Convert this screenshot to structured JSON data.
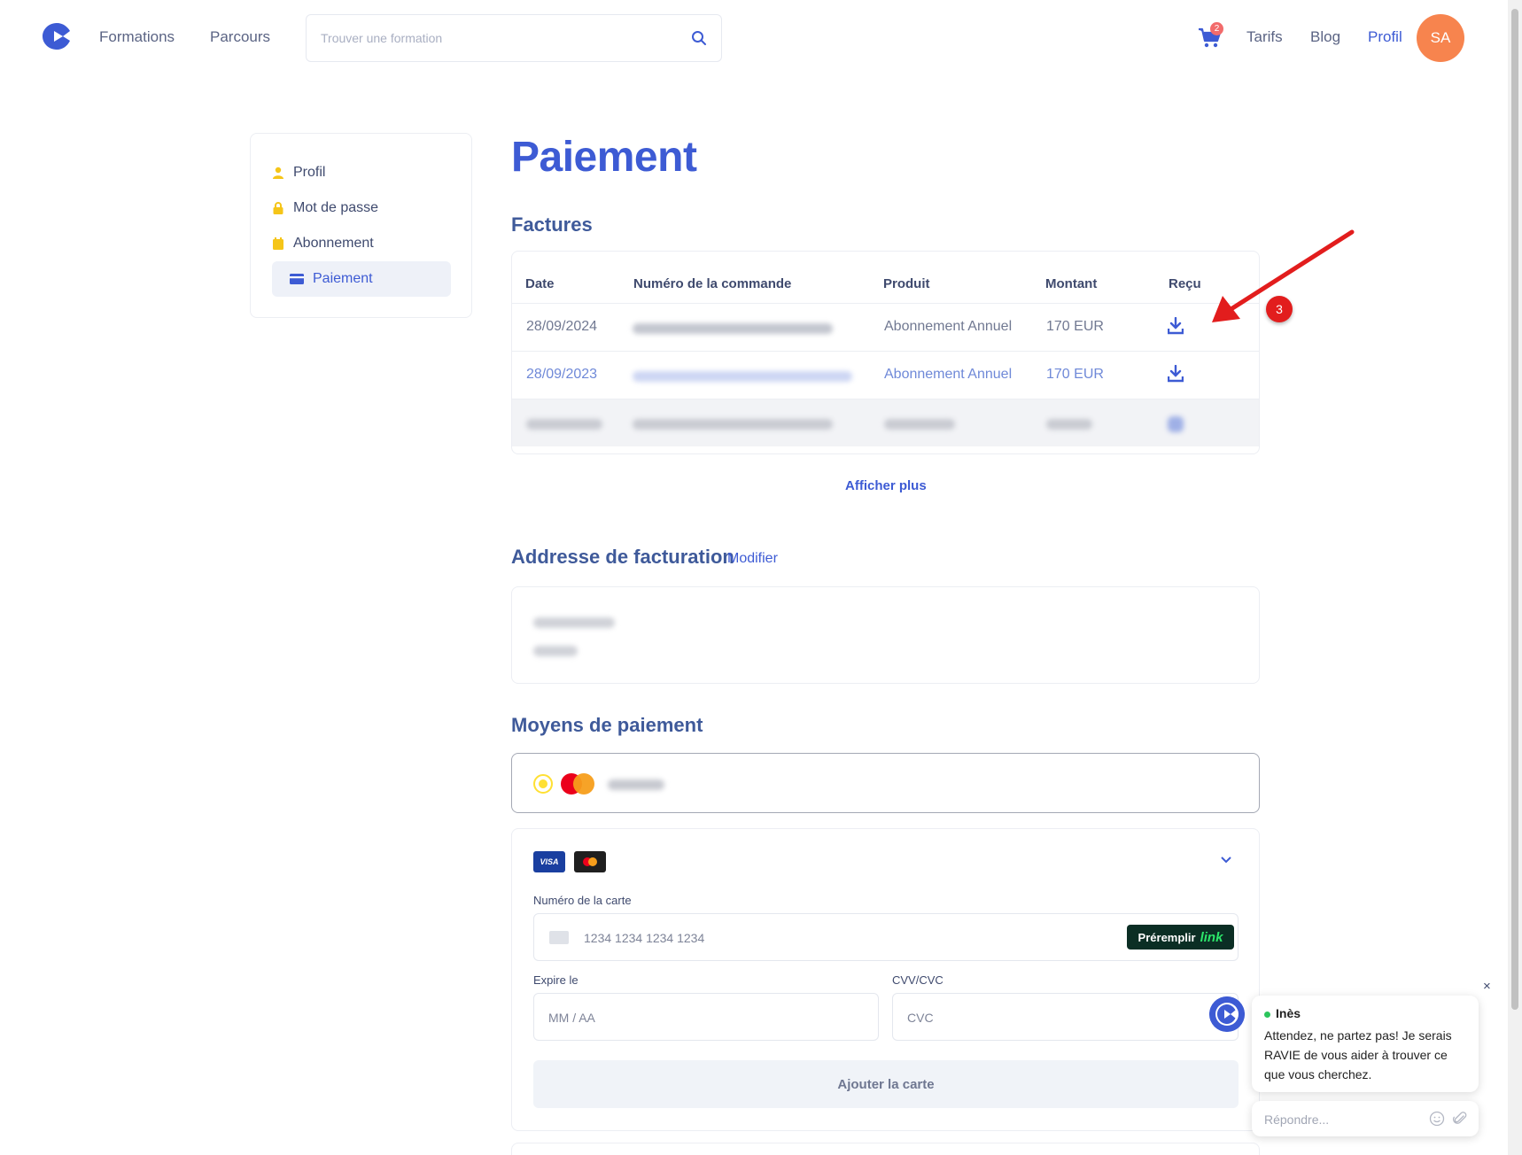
{
  "header": {
    "nav": {
      "formations": "Formations",
      "parcours": "Parcours"
    },
    "search": {
      "placeholder": "Trouver une formation"
    },
    "cart_count": "2",
    "links": {
      "tarifs": "Tarifs",
      "blog": "Blog",
      "profil": "Profil"
    },
    "avatar_initials": "SA"
  },
  "sidebar": {
    "items": [
      {
        "label": "Profil",
        "icon": "user-icon"
      },
      {
        "label": "Mot de passe",
        "icon": "lock-icon"
      },
      {
        "label": "Abonnement",
        "icon": "calendar-icon"
      },
      {
        "label": "Paiement",
        "icon": "credit-card-icon",
        "active": true
      }
    ]
  },
  "main": {
    "title": "Paiement",
    "invoices": {
      "heading": "Factures",
      "columns": [
        "Date",
        "Numéro de la commande",
        "Produit",
        "Montant",
        "Reçu"
      ],
      "rows": [
        {
          "date": "28/09/2024",
          "produit": "Abonnement Annuel",
          "montant": "170 EUR"
        },
        {
          "date": "28/09/2023",
          "produit": "Abonnement Annuel",
          "montant": "170 EUR"
        }
      ],
      "show_more": "Afficher plus"
    },
    "billing": {
      "heading": "Addresse de facturation",
      "modify": "Modifier"
    },
    "payment_methods": {
      "heading": "Moyens de paiement",
      "form": {
        "card_number_label": "Numéro de la carte",
        "card_number_placeholder": "1234 1234 1234 1234",
        "prefill_label": "Préremplir",
        "prefill_brand": "link",
        "expiry_label": "Expire le",
        "expiry_placeholder": "MM / AA",
        "cvc_label": "CVV/CVC",
        "cvc_placeholder": "CVC",
        "visa": "VISA",
        "submit": "Ajouter la carte"
      }
    }
  },
  "annotation": {
    "number": "3"
  },
  "chat": {
    "agent_name": "Inès",
    "message": "Attendez, ne partez pas! Je serais RAVIE de vous aider à trouver ce que vous cherchez.",
    "reply_placeholder": "Répondre...",
    "close": "×"
  },
  "colors": {
    "accent": "#3d5bd4",
    "avatar": "#f7844e",
    "annotation": "#e21d1d",
    "link_green": "#2ce66a"
  }
}
